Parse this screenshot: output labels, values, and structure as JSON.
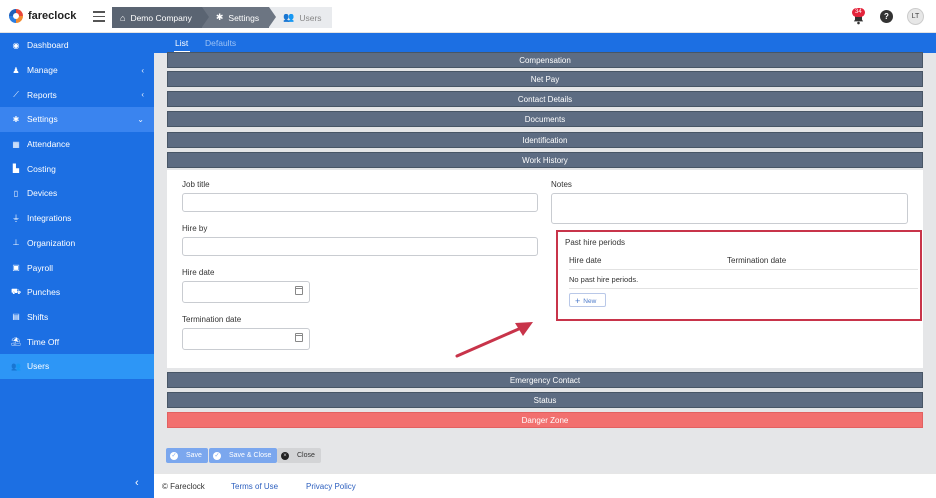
{
  "app": {
    "name": "fareclock"
  },
  "breadcrumb": [
    {
      "label": "Demo Company",
      "icon": "home-icon"
    },
    {
      "label": "Settings",
      "icon": "gear-icon"
    },
    {
      "label": "Users",
      "icon": "users-icon"
    }
  ],
  "header": {
    "notifications_count": "34",
    "help_label": "?",
    "avatar_initials": "LT"
  },
  "sidebar": {
    "items": [
      {
        "label": "Dashboard",
        "icon": "dashboard-icon",
        "chevron": ""
      },
      {
        "label": "Manage",
        "icon": "person-icon",
        "chevron": "‹"
      },
      {
        "label": "Reports",
        "icon": "chart-icon",
        "chevron": "‹"
      },
      {
        "label": "Settings",
        "icon": "gear-icon",
        "chevron": "⌄"
      },
      {
        "label": "Attendance",
        "icon": "attendance-icon",
        "chevron": ""
      },
      {
        "label": "Costing",
        "icon": "costing-icon",
        "chevron": ""
      },
      {
        "label": "Devices",
        "icon": "device-icon",
        "chevron": ""
      },
      {
        "label": "Integrations",
        "icon": "plug-icon",
        "chevron": ""
      },
      {
        "label": "Organization",
        "icon": "org-icon",
        "chevron": ""
      },
      {
        "label": "Payroll",
        "icon": "payroll-icon",
        "chevron": ""
      },
      {
        "label": "Punches",
        "icon": "punch-icon",
        "chevron": ""
      },
      {
        "label": "Shifts",
        "icon": "shifts-icon",
        "chevron": ""
      },
      {
        "label": "Time Off",
        "icon": "timeoff-icon",
        "chevron": ""
      },
      {
        "label": "Users",
        "icon": "users-icon",
        "chevron": ""
      }
    ],
    "collapse_label": "‹"
  },
  "tabs": [
    {
      "label": "List"
    },
    {
      "label": "Defaults"
    }
  ],
  "sections_top": [
    "Compensation",
    "Net Pay",
    "Contact Details",
    "Documents",
    "Identification",
    "Work History"
  ],
  "form": {
    "job_title_label": "Job title",
    "job_title_value": "",
    "hire_by_label": "Hire by",
    "hire_by_value": "",
    "hire_date_label": "Hire date",
    "hire_date_value": "",
    "termination_date_label": "Termination date",
    "termination_date_value": "",
    "notes_label": "Notes",
    "notes_value": ""
  },
  "past_hire": {
    "title": "Past hire periods",
    "columns": [
      "Hire date",
      "Termination date"
    ],
    "empty_text": "No past hire periods.",
    "new_label": "New"
  },
  "sections_bottom": [
    "Emergency Contact",
    "Status",
    "Danger Zone"
  ],
  "actions": {
    "save": "Save",
    "save_close": "Save & Close",
    "close": "Close"
  },
  "footer": {
    "copyright": "© Fareclock",
    "terms": "Terms of Use",
    "privacy": "Privacy Policy"
  },
  "colors": {
    "accent": "#1c6fe3",
    "section": "#5d6c82",
    "danger": "#f2706f",
    "highlight": "#c8344a"
  }
}
